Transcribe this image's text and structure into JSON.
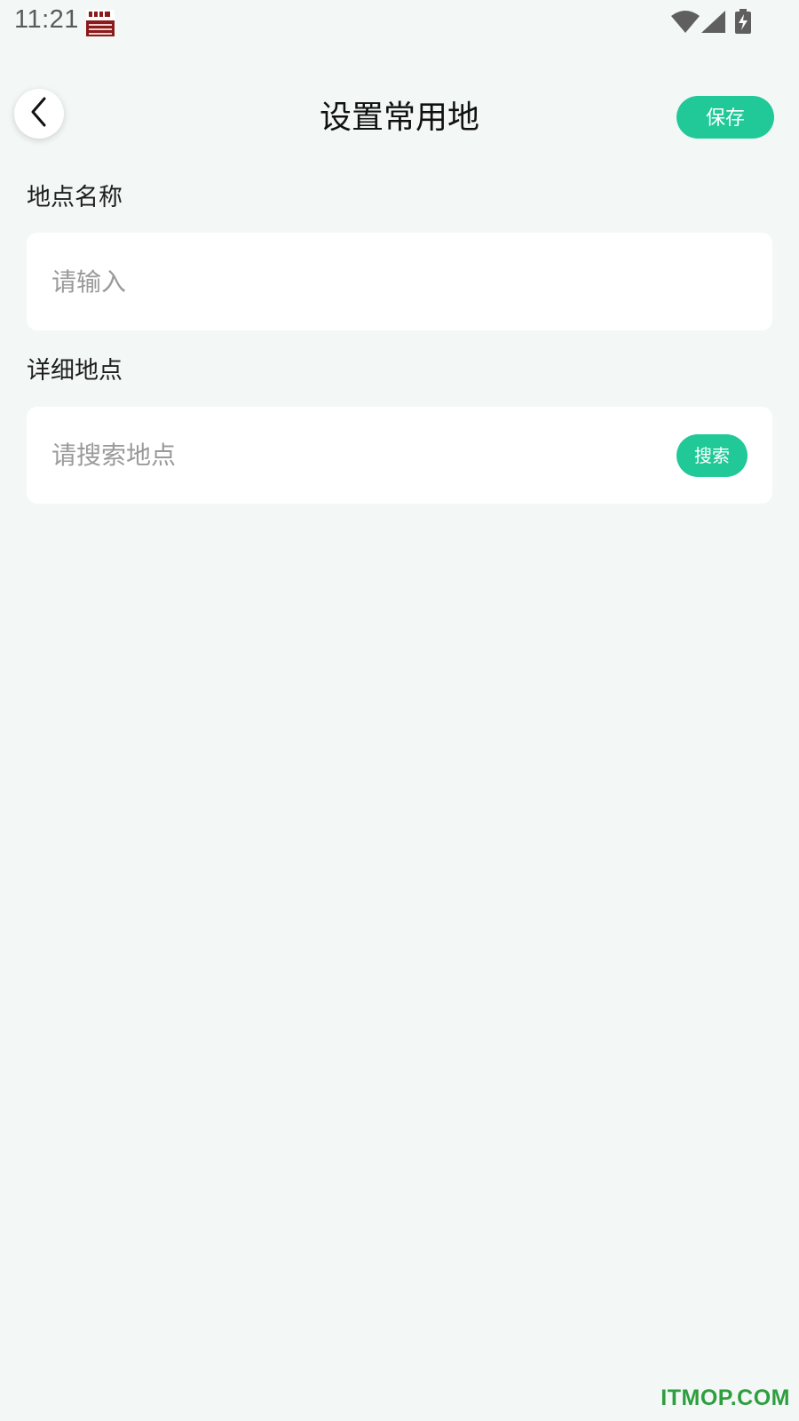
{
  "status_bar": {
    "time": "11:21",
    "app_icon": "notification-app-icon",
    "wifi_icon": "wifi-icon",
    "signal_icon": "signal-icon",
    "battery_icon": "battery-charging-icon"
  },
  "header": {
    "back_icon": "chevron-left-icon",
    "title": "设置常用地",
    "save_label": "保存"
  },
  "form": {
    "name_label": "地点名称",
    "name_placeholder": "请输入",
    "name_value": "",
    "detail_label": "详细地点",
    "detail_placeholder": "请搜索地点",
    "detail_value": "",
    "search_label": "搜索"
  },
  "watermark": "ITMOP.COM",
  "colors": {
    "accent": "#20c997",
    "background": "#f3f8f7",
    "card": "#ffffff",
    "watermark": "#2e9e3e"
  }
}
